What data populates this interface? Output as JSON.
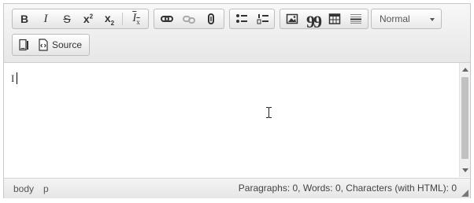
{
  "toolbar": {
    "bold_label": "B",
    "italic_label": "I",
    "strike_label": "S",
    "superscript_label": "x",
    "superscript_mark": "2",
    "subscript_label": "x",
    "subscript_mark": "2",
    "removeformat_label": "I",
    "removeformat_mark": "x",
    "blockquote_label": "99",
    "source_label": "Source",
    "format_value": "Normal"
  },
  "content": {
    "text": "I"
  },
  "status": {
    "path": [
      "body",
      "p"
    ],
    "wordcount": "Paragraphs: 0, Words: 0, Characters (with HTML): 0"
  }
}
